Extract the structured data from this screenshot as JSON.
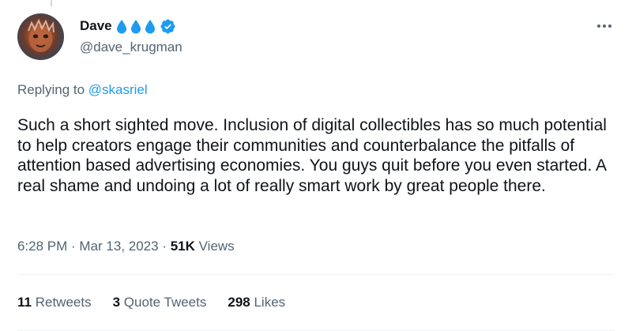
{
  "author": {
    "display_name": "Dave",
    "handle": "@dave_krugman",
    "badges": [
      "water-drop-icon",
      "water-drop-icon",
      "water-drop-icon",
      "verified-badge-icon"
    ]
  },
  "reply": {
    "prefix": "Replying to ",
    "to": "@skasriel"
  },
  "tweet": {
    "text": "Such a short sighted move. Inclusion of digital collectibles has so much potential to help creators engage their communities and counterbalance the pitfalls of attention based advertising economies. You guys quit before you even started. A real shame and undoing a lot of really smart work by great people there."
  },
  "meta": {
    "time": "6:28 PM",
    "sep1": " · ",
    "date": "Mar 13, 2023",
    "sep2": " · ",
    "views_count": "51K",
    "views_label": " Views"
  },
  "stats": {
    "retweets_count": "11",
    "retweets_label": " Retweets",
    "quotes_count": "3",
    "quotes_label": " Quote Tweets",
    "likes_count": "298",
    "likes_label": " Likes"
  },
  "colors": {
    "accent": "#1d9bf0",
    "secondary_text": "#536471",
    "primary_text": "#0f1419",
    "divider": "#eff3f4"
  }
}
